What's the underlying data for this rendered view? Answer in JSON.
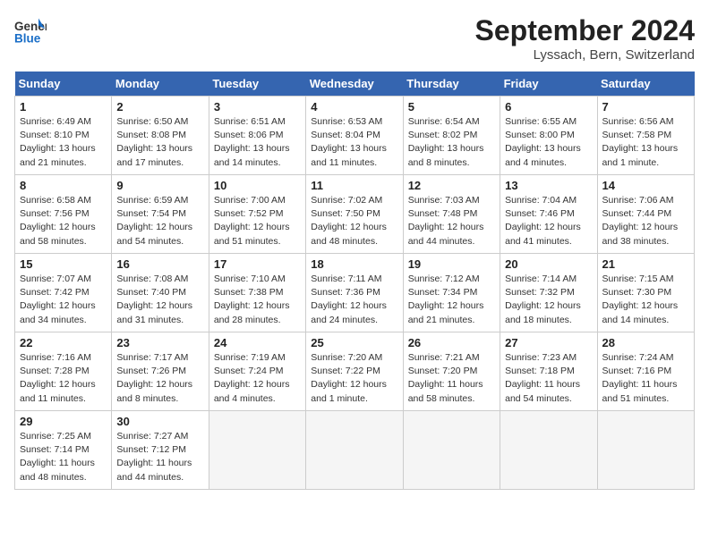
{
  "header": {
    "logo_general": "General",
    "logo_blue": "Blue",
    "month_year": "September 2024",
    "location": "Lyssach, Bern, Switzerland"
  },
  "days_of_week": [
    "Sunday",
    "Monday",
    "Tuesday",
    "Wednesday",
    "Thursday",
    "Friday",
    "Saturday"
  ],
  "weeks": [
    [
      {
        "day": "1",
        "sunrise": "Sunrise: 6:49 AM",
        "sunset": "Sunset: 8:10 PM",
        "daylight": "Daylight: 13 hours and 21 minutes."
      },
      {
        "day": "2",
        "sunrise": "Sunrise: 6:50 AM",
        "sunset": "Sunset: 8:08 PM",
        "daylight": "Daylight: 13 hours and 17 minutes."
      },
      {
        "day": "3",
        "sunrise": "Sunrise: 6:51 AM",
        "sunset": "Sunset: 8:06 PM",
        "daylight": "Daylight: 13 hours and 14 minutes."
      },
      {
        "day": "4",
        "sunrise": "Sunrise: 6:53 AM",
        "sunset": "Sunset: 8:04 PM",
        "daylight": "Daylight: 13 hours and 11 minutes."
      },
      {
        "day": "5",
        "sunrise": "Sunrise: 6:54 AM",
        "sunset": "Sunset: 8:02 PM",
        "daylight": "Daylight: 13 hours and 8 minutes."
      },
      {
        "day": "6",
        "sunrise": "Sunrise: 6:55 AM",
        "sunset": "Sunset: 8:00 PM",
        "daylight": "Daylight: 13 hours and 4 minutes."
      },
      {
        "day": "7",
        "sunrise": "Sunrise: 6:56 AM",
        "sunset": "Sunset: 7:58 PM",
        "daylight": "Daylight: 13 hours and 1 minute."
      }
    ],
    [
      {
        "day": "8",
        "sunrise": "Sunrise: 6:58 AM",
        "sunset": "Sunset: 7:56 PM",
        "daylight": "Daylight: 12 hours and 58 minutes."
      },
      {
        "day": "9",
        "sunrise": "Sunrise: 6:59 AM",
        "sunset": "Sunset: 7:54 PM",
        "daylight": "Daylight: 12 hours and 54 minutes."
      },
      {
        "day": "10",
        "sunrise": "Sunrise: 7:00 AM",
        "sunset": "Sunset: 7:52 PM",
        "daylight": "Daylight: 12 hours and 51 minutes."
      },
      {
        "day": "11",
        "sunrise": "Sunrise: 7:02 AM",
        "sunset": "Sunset: 7:50 PM",
        "daylight": "Daylight: 12 hours and 48 minutes."
      },
      {
        "day": "12",
        "sunrise": "Sunrise: 7:03 AM",
        "sunset": "Sunset: 7:48 PM",
        "daylight": "Daylight: 12 hours and 44 minutes."
      },
      {
        "day": "13",
        "sunrise": "Sunrise: 7:04 AM",
        "sunset": "Sunset: 7:46 PM",
        "daylight": "Daylight: 12 hours and 41 minutes."
      },
      {
        "day": "14",
        "sunrise": "Sunrise: 7:06 AM",
        "sunset": "Sunset: 7:44 PM",
        "daylight": "Daylight: 12 hours and 38 minutes."
      }
    ],
    [
      {
        "day": "15",
        "sunrise": "Sunrise: 7:07 AM",
        "sunset": "Sunset: 7:42 PM",
        "daylight": "Daylight: 12 hours and 34 minutes."
      },
      {
        "day": "16",
        "sunrise": "Sunrise: 7:08 AM",
        "sunset": "Sunset: 7:40 PM",
        "daylight": "Daylight: 12 hours and 31 minutes."
      },
      {
        "day": "17",
        "sunrise": "Sunrise: 7:10 AM",
        "sunset": "Sunset: 7:38 PM",
        "daylight": "Daylight: 12 hours and 28 minutes."
      },
      {
        "day": "18",
        "sunrise": "Sunrise: 7:11 AM",
        "sunset": "Sunset: 7:36 PM",
        "daylight": "Daylight: 12 hours and 24 minutes."
      },
      {
        "day": "19",
        "sunrise": "Sunrise: 7:12 AM",
        "sunset": "Sunset: 7:34 PM",
        "daylight": "Daylight: 12 hours and 21 minutes."
      },
      {
        "day": "20",
        "sunrise": "Sunrise: 7:14 AM",
        "sunset": "Sunset: 7:32 PM",
        "daylight": "Daylight: 12 hours and 18 minutes."
      },
      {
        "day": "21",
        "sunrise": "Sunrise: 7:15 AM",
        "sunset": "Sunset: 7:30 PM",
        "daylight": "Daylight: 12 hours and 14 minutes."
      }
    ],
    [
      {
        "day": "22",
        "sunrise": "Sunrise: 7:16 AM",
        "sunset": "Sunset: 7:28 PM",
        "daylight": "Daylight: 12 hours and 11 minutes."
      },
      {
        "day": "23",
        "sunrise": "Sunrise: 7:17 AM",
        "sunset": "Sunset: 7:26 PM",
        "daylight": "Daylight: 12 hours and 8 minutes."
      },
      {
        "day": "24",
        "sunrise": "Sunrise: 7:19 AM",
        "sunset": "Sunset: 7:24 PM",
        "daylight": "Daylight: 12 hours and 4 minutes."
      },
      {
        "day": "25",
        "sunrise": "Sunrise: 7:20 AM",
        "sunset": "Sunset: 7:22 PM",
        "daylight": "Daylight: 12 hours and 1 minute."
      },
      {
        "day": "26",
        "sunrise": "Sunrise: 7:21 AM",
        "sunset": "Sunset: 7:20 PM",
        "daylight": "Daylight: 11 hours and 58 minutes."
      },
      {
        "day": "27",
        "sunrise": "Sunrise: 7:23 AM",
        "sunset": "Sunset: 7:18 PM",
        "daylight": "Daylight: 11 hours and 54 minutes."
      },
      {
        "day": "28",
        "sunrise": "Sunrise: 7:24 AM",
        "sunset": "Sunset: 7:16 PM",
        "daylight": "Daylight: 11 hours and 51 minutes."
      }
    ],
    [
      {
        "day": "29",
        "sunrise": "Sunrise: 7:25 AM",
        "sunset": "Sunset: 7:14 PM",
        "daylight": "Daylight: 11 hours and 48 minutes."
      },
      {
        "day": "30",
        "sunrise": "Sunrise: 7:27 AM",
        "sunset": "Sunset: 7:12 PM",
        "daylight": "Daylight: 11 hours and 44 minutes."
      },
      null,
      null,
      null,
      null,
      null
    ]
  ]
}
